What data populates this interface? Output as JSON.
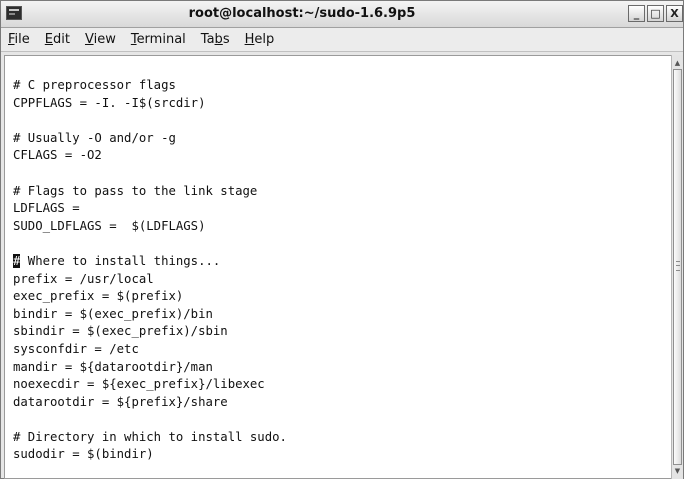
{
  "window": {
    "title": "root@localhost:~/sudo-1.6.9p5",
    "icon": "terminal-app-icon",
    "buttons": {
      "minimize": "_",
      "maximize": "□",
      "close": "X"
    }
  },
  "menu": [
    {
      "label": "File",
      "mnemonic": "F",
      "rest": "ile"
    },
    {
      "label": "Edit",
      "mnemonic": "E",
      "rest": "dit"
    },
    {
      "label": "View",
      "mnemonic": "V",
      "rest": "iew"
    },
    {
      "label": "Terminal",
      "mnemonic": "T",
      "rest": "erminal"
    },
    {
      "label": "Tabs",
      "pre": "Ta",
      "mnemonic": "b",
      "rest": "s"
    },
    {
      "label": "Help",
      "mnemonic": "H",
      "rest": "elp"
    }
  ],
  "terminal": {
    "lines": [
      "# C preprocessor flags",
      "CPPFLAGS = -I. -I$(srcdir)",
      "",
      "# Usually -O and/or -g",
      "CFLAGS = -O2",
      "",
      "# Flags to pass to the link stage",
      "LDFLAGS =",
      "SUDO_LDFLAGS =  $(LDFLAGS)",
      "",
      "# Where to install things...",
      "prefix = /usr/local",
      "exec_prefix = $(prefix)",
      "bindir = $(exec_prefix)/bin",
      "sbindir = $(exec_prefix)/sbin",
      "sysconfdir = /etc",
      "mandir = ${datarootdir}/man",
      "noexecdir = ${exec_prefix}/libexec",
      "datarootdir = ${prefix}/share",
      "",
      "# Directory in which to install sudo.",
      "sudodir = $(bindir)"
    ],
    "cursor": {
      "line": 10,
      "char": "#"
    }
  },
  "scrollbar": {
    "position": 0.0
  }
}
